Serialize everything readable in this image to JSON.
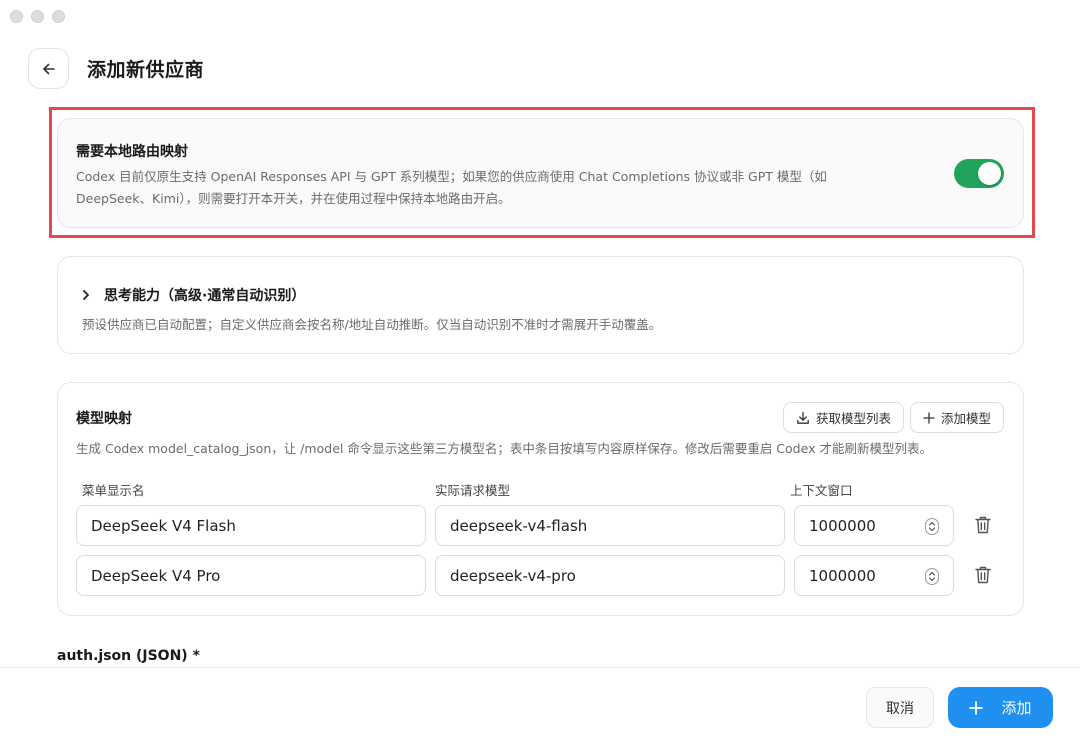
{
  "header": {
    "title": "添加新供应商"
  },
  "routing": {
    "title": "需要本地路由映射",
    "description": "Codex 目前仅原生支持 OpenAI Responses API 与 GPT 系列模型；如果您的供应商使用 Chat Completions 协议或非 GPT 模型（如 DeepSeek、Kimi），则需要打开本开关，并在使用过程中保持本地路由开启。",
    "enabled": true,
    "toggle_color": "#21a35b",
    "highlight_color": "#e5484d"
  },
  "thinking": {
    "title": "思考能力（高级·通常自动识别）",
    "description": "预设供应商已自动配置；自定义供应商会按名称/地址自动推断。仅当自动识别不准时才需展开手动覆盖。"
  },
  "mapping": {
    "title": "模型映射",
    "description": "生成 Codex model_catalog_json，让 /model 命令显示这些第三方模型名；表中条目按填写内容原样保存。修改后需要重启 Codex 才能刷新模型列表。",
    "fetch_label": "获取模型列表",
    "add_model_label": "添加模型",
    "columns": {
      "display_name": "菜单显示名",
      "request_model": "实际请求模型",
      "context_window": "上下文窗口"
    },
    "rows": [
      {
        "display_name": "DeepSeek V4 Flash",
        "request_model": "deepseek-v4-flash",
        "context_window": "1000000"
      },
      {
        "display_name": "DeepSeek V4 Pro",
        "request_model": "deepseek-v4-pro",
        "context_window": "1000000"
      }
    ]
  },
  "auth": {
    "label": "auth.json (JSON) *"
  },
  "footer": {
    "cancel_label": "取消",
    "add_label": "添加",
    "accent_color": "#1f8ff0"
  }
}
